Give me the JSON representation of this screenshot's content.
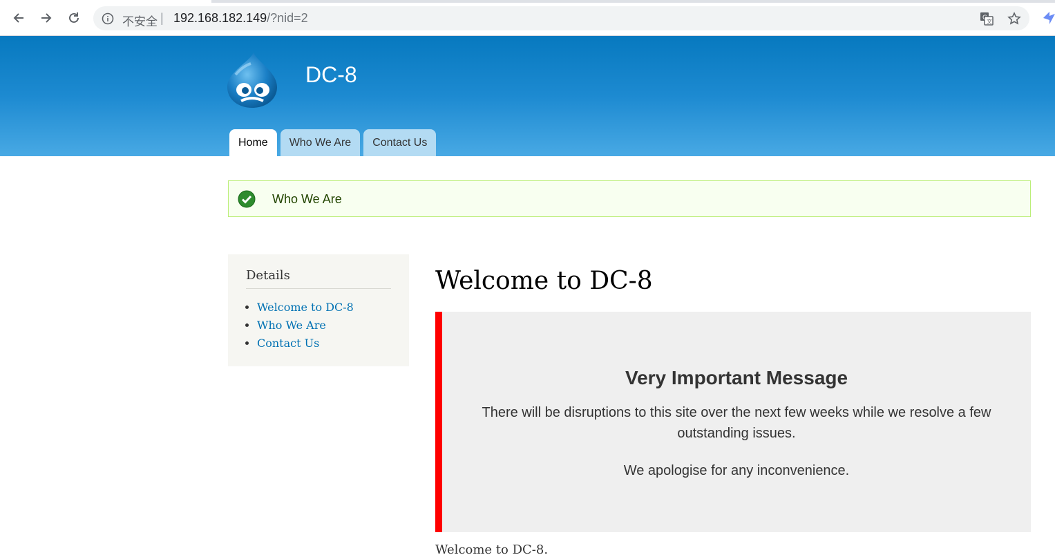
{
  "browser": {
    "security_label": "不安全",
    "separator": "|",
    "url_host": "192.168.182.149",
    "url_path": "/?nid=2",
    "icons": [
      "back-arrow-icon",
      "forward-arrow-icon",
      "reload-icon",
      "info-icon",
      "translate-icon",
      "star-icon",
      "extension-icon"
    ]
  },
  "site": {
    "name": "DC-8",
    "logo": "drupal-drop-logo",
    "tabs": [
      {
        "label": "Home",
        "active": true
      },
      {
        "label": "Who We Are",
        "active": false
      },
      {
        "label": "Contact Us",
        "active": false
      }
    ]
  },
  "status_message": {
    "text": "Who We Are",
    "icon": "check-circle-icon"
  },
  "sidebar": {
    "title": "Details",
    "links": [
      "Welcome to DC-8",
      "Who We Are",
      "Contact Us"
    ]
  },
  "main": {
    "title": "Welcome to DC-8",
    "notice": {
      "heading": "Very Important Message",
      "paragraph1": "There will be disruptions to this site over the next few weeks while we resolve a few outstanding issues.",
      "paragraph2": "We apologise for any inconvenience."
    },
    "body": "Welcome to DC-8."
  },
  "colors": {
    "header_top": "#0779bf",
    "header_bottom": "#48a9e4",
    "tab_inactive": "#b3dbf3",
    "link": "#0071b3",
    "notice_border": "#ff0000",
    "status_bg": "#f8fff0"
  }
}
